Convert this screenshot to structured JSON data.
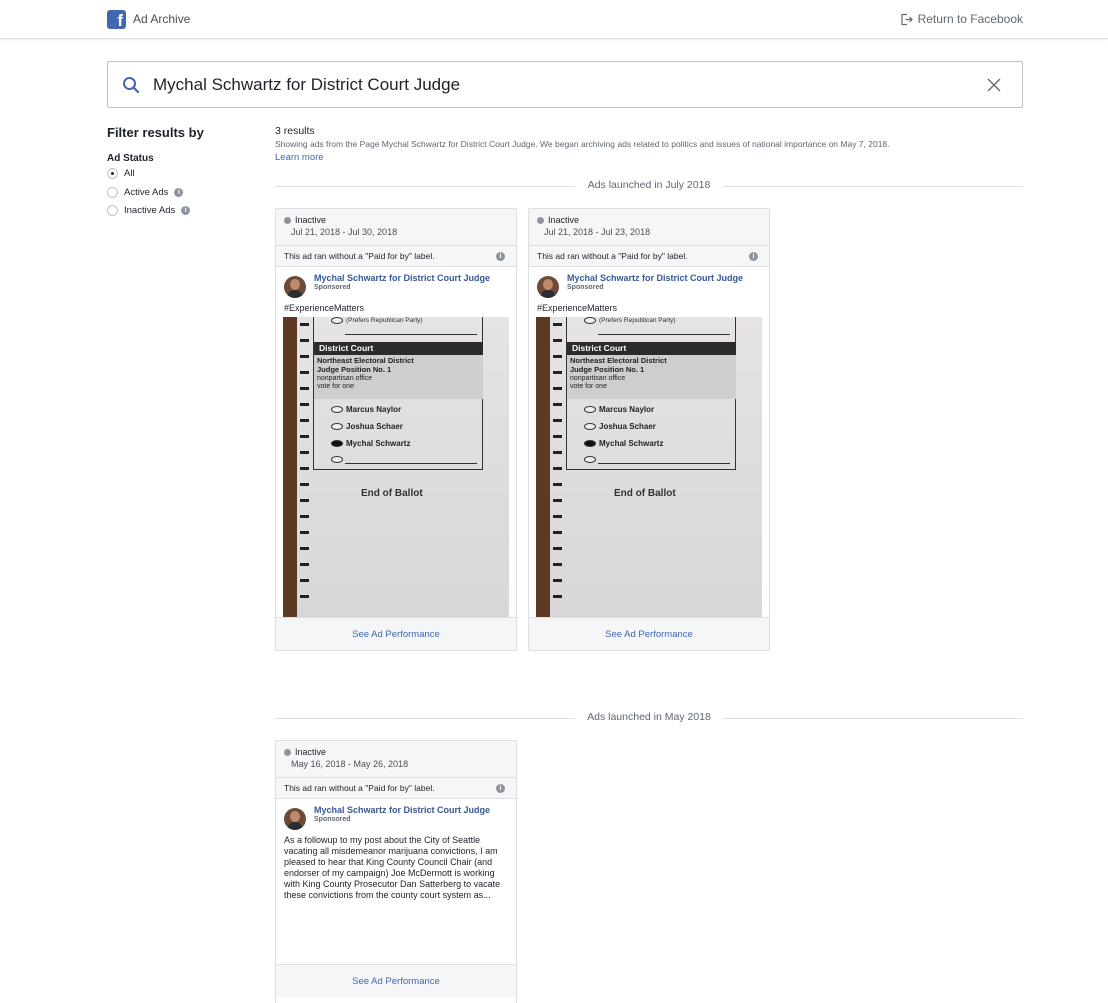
{
  "header": {
    "brand": "Ad Archive",
    "return_label": "Return to Facebook"
  },
  "search": {
    "value": "Mychal Schwartz for District Court Judge"
  },
  "sidebar": {
    "title": "Filter results by",
    "ad_status_label": "Ad Status",
    "options": [
      {
        "label": "All",
        "selected": true
      },
      {
        "label": "Active Ads",
        "selected": false
      },
      {
        "label": "Inactive Ads",
        "selected": false
      }
    ]
  },
  "results": {
    "count": "3 results",
    "description": "Showing ads from the Page Mychal Schwartz for District Court Judge. We began archiving ads related to politics and issues of national importance on May 7, 2018.",
    "learn_more": "Learn more"
  },
  "sections": [
    {
      "label": "Ads launched in July 2018",
      "cards": [
        {
          "status": "Inactive",
          "dates": "Jul 21, 2018 - Jul 30, 2018",
          "disclaimer": "This ad ran without a \"Paid for by\" label.",
          "page_name": "Mychal Schwartz for District Court Judge",
          "sponsored": "Sponsored",
          "text": "#ExperienceMatters",
          "perf": "See Ad Performance"
        },
        {
          "status": "Inactive",
          "dates": "Jul 21, 2018 - Jul 23, 2018",
          "disclaimer": "This ad ran without a \"Paid for by\" label.",
          "page_name": "Mychal Schwartz for District Court Judge",
          "sponsored": "Sponsored",
          "text": "#ExperienceMatters",
          "perf": "See Ad Performance"
        }
      ]
    },
    {
      "label": "Ads launched in May 2018",
      "cards": [
        {
          "status": "Inactive",
          "dates": "May 16, 2018 - May 26, 2018",
          "disclaimer": "This ad ran without a \"Paid for by\" label.",
          "page_name": "Mychal Schwartz for District Court Judge",
          "sponsored": "Sponsored",
          "text": "As a followup to my post about the City of Seattle vacating all misdemeanor marijuana convictions, I am pleased to hear that King County Council Chair (and endorser of my campaign) Joe McDermott is working with King County Prosecutor Dan Satterberg to vacate these convictions from the county court system as...",
          "perf": "See Ad Performance"
        }
      ]
    }
  ],
  "ballot": {
    "prefers": "(Prefers Republican Party)",
    "court": "District Court",
    "district": "Northeast Electoral District",
    "position": "Judge Position No. 1",
    "office": "nonpartisan office",
    "vote": "vote for one",
    "candidates": [
      "Marcus Naylor",
      "Joshua Schaer",
      "Mychal Schwartz"
    ],
    "end": "End of Ballot"
  },
  "icons": {
    "brand_logo": "facebook-logo-icon",
    "return": "exit-icon",
    "search": "search-icon",
    "clear": "close-icon",
    "info": "info-icon"
  },
  "colors": {
    "link": "#4267b2",
    "page_name": "#385898",
    "panel": "#f5f6f7"
  }
}
